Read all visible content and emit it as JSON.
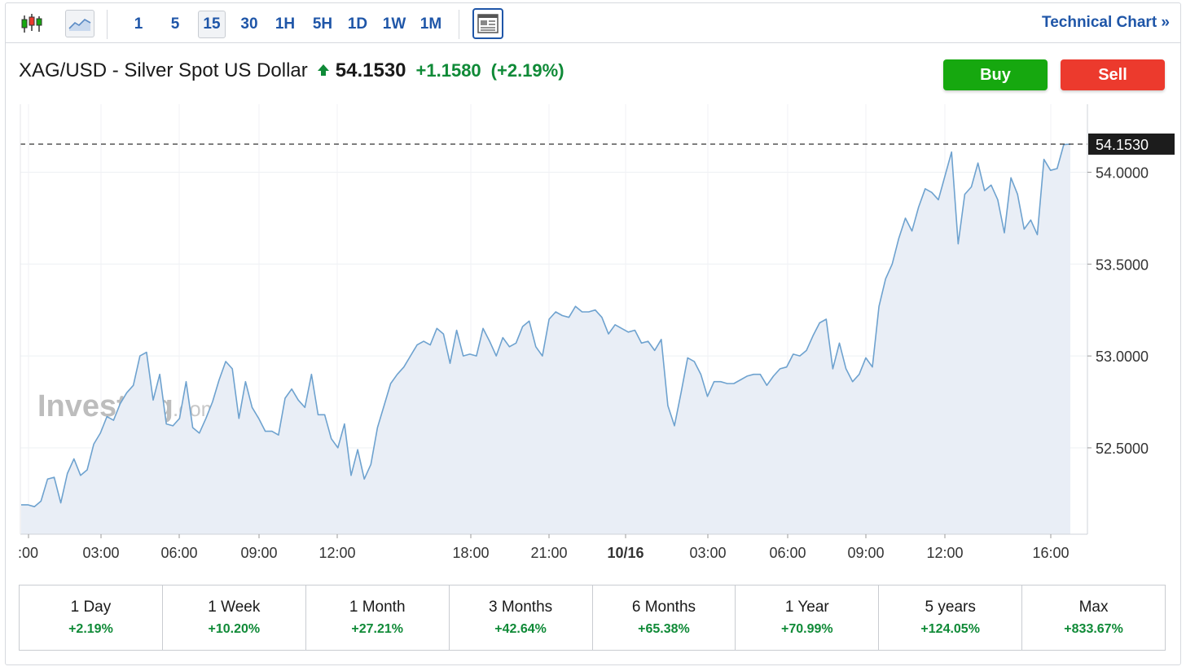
{
  "toolbar": {
    "intervals": [
      "1",
      "5",
      "15",
      "30",
      "1H",
      "5H",
      "1D",
      "1W",
      "1M"
    ],
    "selected_interval": "15",
    "technical_link": "Technical Chart »",
    "accent_color": "#1f56a8"
  },
  "header": {
    "title": "XAG/USD - Silver Spot US Dollar",
    "last": "54.1530",
    "change": "+1.1580",
    "change_pct": "(+2.19%)",
    "up_color": "#0f8a37"
  },
  "actions": {
    "buy": "Buy",
    "sell": "Sell",
    "buy_color": "#16a80f",
    "sell_color": "#ec3a2d"
  },
  "watermark": {
    "brand": "Investing",
    "suffix": ".com"
  },
  "periods": [
    {
      "label": "1 Day",
      "value": "+2.19%"
    },
    {
      "label": "1 Week",
      "value": "+10.20%"
    },
    {
      "label": "1 Month",
      "value": "+27.21%"
    },
    {
      "label": "3 Months",
      "value": "+42.64%"
    },
    {
      "label": "6 Months",
      "value": "+65.38%"
    },
    {
      "label": "1 Year",
      "value": "+70.99%"
    },
    {
      "label": "5 years",
      "value": "+124.05%"
    },
    {
      "label": "Max",
      "value": "+833.67%"
    }
  ],
  "chart_data": {
    "type": "area",
    "title": "",
    "xlabel": "",
    "ylabel": "",
    "ylim": [
      52.03,
      54.37
    ],
    "y_ticks": [
      "54.0000",
      "53.5000",
      "53.0000",
      "52.5000"
    ],
    "y_tick_values": [
      54.0,
      53.5,
      53.0,
      52.5
    ],
    "x_ticks": [
      ":00",
      "03:00",
      "06:00",
      "09:00",
      "12:00",
      "18:00",
      "21:00",
      "10/16",
      "03:00",
      "06:00",
      "09:00",
      "12:00",
      "16:00"
    ],
    "x_tick_bold": "10/16",
    "last_price_label": "54.1530",
    "last_price": 54.153,
    "grid": true,
    "line_color": "#6ea2cf",
    "fill_color": "#e9eef6",
    "values": [
      52.19,
      52.19,
      52.18,
      52.21,
      52.33,
      52.34,
      52.2,
      52.36,
      52.44,
      52.35,
      52.38,
      52.52,
      52.58,
      52.67,
      52.65,
      52.74,
      52.8,
      52.84,
      53.0,
      53.02,
      52.76,
      52.9,
      52.63,
      52.62,
      52.66,
      52.86,
      52.61,
      52.58,
      52.66,
      52.75,
      52.87,
      52.97,
      52.93,
      52.66,
      52.86,
      52.72,
      52.66,
      52.59,
      52.59,
      52.57,
      52.77,
      52.82,
      52.76,
      52.72,
      52.9,
      52.68,
      52.68,
      52.55,
      52.5,
      52.63,
      52.35,
      52.49,
      52.33,
      52.41,
      52.61,
      52.73,
      52.85,
      52.9,
      52.94,
      53.0,
      53.06,
      53.08,
      53.06,
      53.15,
      53.12,
      52.96,
      53.14,
      53.0,
      53.01,
      53.0,
      53.15,
      53.08,
      53.0,
      53.1,
      53.05,
      53.07,
      53.16,
      53.19,
      53.05,
      53.0,
      53.2,
      53.24,
      53.22,
      53.21,
      53.27,
      53.24,
      53.24,
      53.25,
      53.21,
      53.12,
      53.17,
      53.15,
      53.13,
      53.14,
      53.07,
      53.08,
      53.03,
      53.09,
      52.73,
      52.62,
      52.8,
      52.99,
      52.97,
      52.9,
      52.78,
      52.86,
      52.86,
      52.85,
      52.85,
      52.87,
      52.89,
      52.9,
      52.9,
      52.84,
      52.89,
      52.93,
      52.94,
      53.01,
      53.0,
      53.03,
      53.11,
      53.18,
      53.2,
      52.93,
      53.07,
      52.93,
      52.86,
      52.9,
      52.99,
      52.94,
      53.27,
      53.42,
      53.5,
      53.64,
      53.75,
      53.68,
      53.81,
      53.91,
      53.89,
      53.85,
      53.98,
      54.11,
      53.61,
      53.88,
      53.92,
      54.05,
      53.9,
      53.93,
      53.85,
      53.67,
      53.97,
      53.88,
      53.69,
      53.74,
      53.66,
      54.07,
      54.01,
      54.02,
      54.15,
      54.153
    ]
  }
}
